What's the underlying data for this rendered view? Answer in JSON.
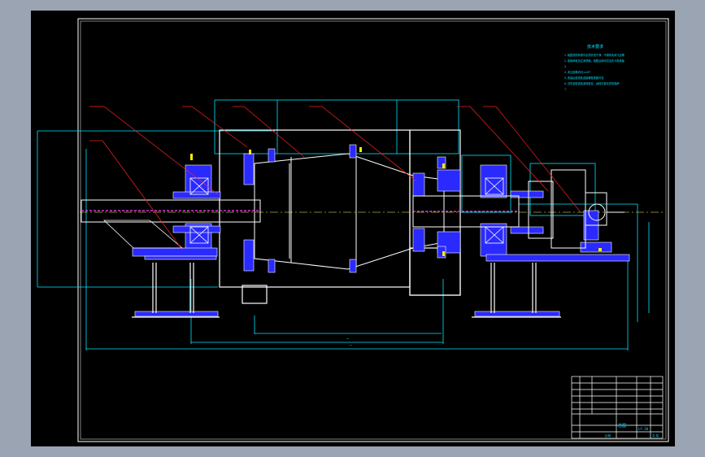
{
  "app": {
    "background_color": "#9aa4b2",
    "canvas_color": "#000000"
  },
  "colors": {
    "outline": "#ffffff",
    "dimension": "#00e5ff",
    "leader": "#ff2020",
    "part_fill": "#2a2aff",
    "accent": "#ff40ff",
    "highlight": "#ffee00",
    "centerline": "#ffff66"
  },
  "notes": {
    "title": "技术要求",
    "lines": [
      "1.装配前所有零件必须清洗干净，不得有毛刺飞边等",
      "2.各轴承处加注润滑脂，装配后转动灵活无卡阻现象",
      "3.",
      "4.未注倒角均为1×45°",
      "5.安装后检查各连接螺栓紧固可靠",
      "6.试车前检查各润滑部位，运转平稳无异常噪声",
      "7."
    ]
  },
  "dimensions": {
    "inner_span": "—",
    "overall_span": "—"
  },
  "title_block": {
    "drawing_name": "总图",
    "drawing_number": "LY-20",
    "scale_label": "比例",
    "sheet_label": "共 张"
  }
}
